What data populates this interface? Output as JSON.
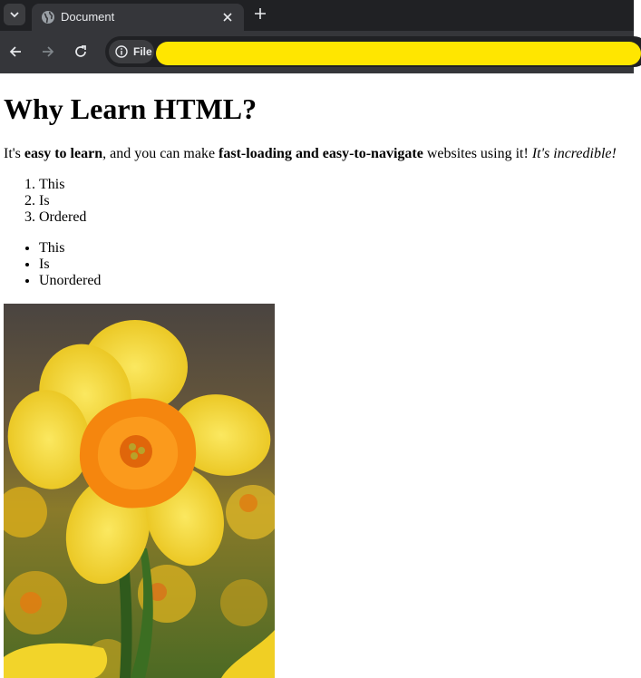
{
  "browser": {
    "tab_title": "Document",
    "site_chip_label": "File"
  },
  "page": {
    "heading": "Why Learn HTML?",
    "intro": {
      "t1": "It's ",
      "b1": "easy to learn",
      "t2": ", and you can make ",
      "b2": "fast-loading and easy-to-navigate",
      "t3": " websites using it! ",
      "i1": "It's incredible!"
    },
    "ordered_list": [
      "This",
      "Is",
      "Ordered"
    ],
    "unordered_list": [
      "This",
      "Is",
      "Unordered"
    ]
  },
  "colors": {
    "chrome_dark": "#202124",
    "chrome_mid": "#35363a",
    "redaction": "#ffe600",
    "petal": "#f7d92b",
    "trumpet": "#f77f0a"
  }
}
